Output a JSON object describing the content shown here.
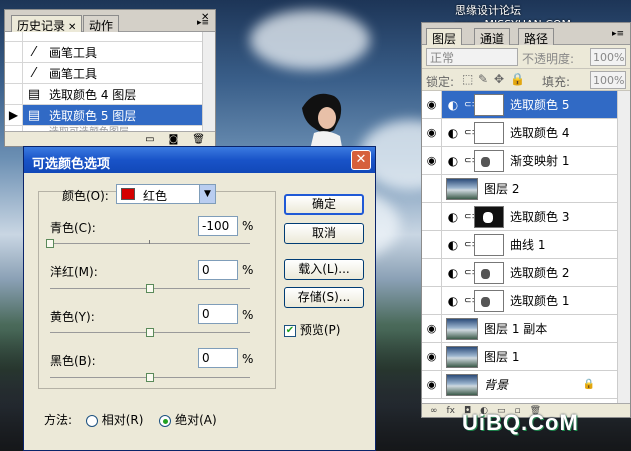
{
  "watermarks": {
    "top": "思缘设计论坛 www.MISSYUAN.COM",
    "bottom": "UiBQ.CoM"
  },
  "history": {
    "tabs": [
      "历史记录",
      "动作"
    ],
    "items": [
      {
        "label": "画笔工具",
        "icon": "brush-icon"
      },
      {
        "label": "画笔工具",
        "icon": "brush-icon"
      },
      {
        "label": "选取颜色 4 图层",
        "icon": "adjustment-layer-icon"
      },
      {
        "label": "选取颜色 5 图层",
        "icon": "adjustment-layer-icon",
        "selected": true
      }
    ],
    "ghost": "选取可选颜色图层"
  },
  "dialog": {
    "title": "可选颜色选项",
    "colors_label": "颜色(O):",
    "color_value": "红色",
    "color_swatch": "#d40000",
    "channels": [
      {
        "label": "青色(C):",
        "value": "-100",
        "pct": "%",
        "thumb_pct": 0
      },
      {
        "label": "洋红(M):",
        "value": "0",
        "pct": "%",
        "thumb_pct": 50
      },
      {
        "label": "黄色(Y):",
        "value": "0",
        "pct": "%",
        "thumb_pct": 50
      },
      {
        "label": "黑色(B):",
        "value": "0",
        "pct": "%",
        "thumb_pct": 50
      }
    ],
    "buttons": {
      "ok": "确定",
      "cancel": "取消",
      "load": "载入(L)...",
      "save": "存储(S)..."
    },
    "preview_label": "预览(P)",
    "method_label": "方法:",
    "method_relative": "相对(R)",
    "method_absolute": "绝对(A)"
  },
  "layers": {
    "tabs": [
      "图层",
      "通道",
      "路径"
    ],
    "blend_mode": "正常",
    "opacity_label": "不透明度:",
    "opacity_value": "100%",
    "lock_label": "锁定:",
    "fill_label": "填充:",
    "fill_value": "100%",
    "items": [
      {
        "name": "选取颜色 5",
        "visible": true,
        "type": "adjust",
        "mask": "white",
        "selected": true
      },
      {
        "name": "选取颜色 4",
        "visible": true,
        "type": "adjust",
        "mask": "white"
      },
      {
        "name": "渐变映射 1",
        "visible": true,
        "type": "adjust",
        "mask": "blob"
      },
      {
        "name": "图层 2",
        "visible": false,
        "type": "photo"
      },
      {
        "name": "选取颜色 3",
        "visible": false,
        "type": "adjust",
        "mask": "dark"
      },
      {
        "name": "曲线 1",
        "visible": false,
        "type": "adjust",
        "mask": "white"
      },
      {
        "name": "选取颜色 2",
        "visible": false,
        "type": "adjust",
        "mask": "blob"
      },
      {
        "name": "选取颜色 1",
        "visible": false,
        "type": "adjust",
        "mask": "blob"
      },
      {
        "name": "图层 1 副本",
        "visible": true,
        "type": "photo"
      },
      {
        "name": "图层 1",
        "visible": true,
        "type": "photo"
      },
      {
        "name": "背景",
        "visible": true,
        "type": "photo",
        "locked": true
      }
    ]
  }
}
